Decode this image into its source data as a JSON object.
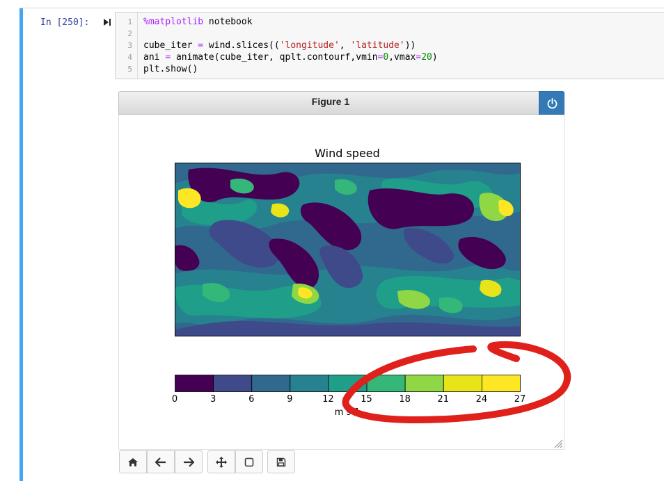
{
  "cell": {
    "prompt": "In [250]:",
    "code_lines": [
      {
        "n": "1",
        "text": "%matplotlib notebook"
      },
      {
        "n": "2",
        "text": ""
      },
      {
        "n": "3",
        "text": "cube_iter = wind.slices(('longitude', 'latitude'))"
      },
      {
        "n": "4",
        "text": "ani = animate(cube_iter, qplt.contourf,vmin=0,vmax=20)"
      },
      {
        "n": "5",
        "text": "plt.show()"
      }
    ]
  },
  "figure": {
    "title": "Figure 1",
    "power_icon": "power-icon",
    "toolbar": [
      "home-icon",
      "back-arrow-icon",
      "forward-arrow-icon",
      "move-icon",
      "zoom-rect-icon",
      "save-icon"
    ]
  },
  "chart_data": {
    "type": "heatmap",
    "title": "Wind speed",
    "colorbar": {
      "ticks": [
        "0",
        "3",
        "6",
        "9",
        "12",
        "15",
        "18",
        "21",
        "24",
        "27"
      ],
      "levels": [
        0,
        3,
        6,
        9,
        12,
        15,
        18,
        21,
        24,
        27
      ],
      "colors": [
        "#440154",
        "#3e4a89",
        "#31688e",
        "#26828e",
        "#1f9e89",
        "#35b779",
        "#8fd744",
        "#e8e419",
        "#fde725"
      ],
      "units": "m s-1"
    },
    "colormap": "viridis"
  },
  "annotation": {
    "color": "#e0201b",
    "shape": "hand-drawn circle around colorbar 15–27"
  }
}
